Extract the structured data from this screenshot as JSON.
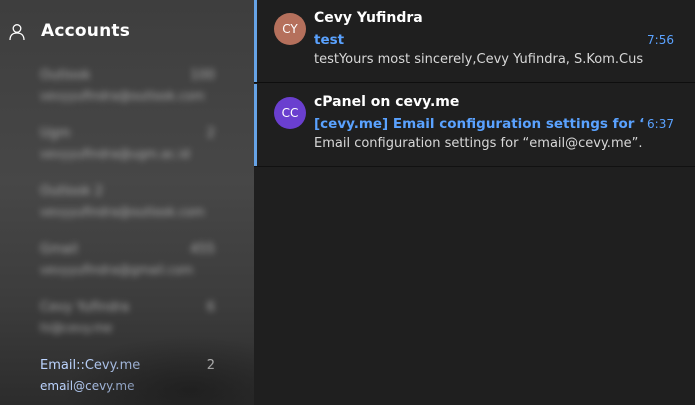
{
  "sidebar": {
    "title": "Accounts",
    "accounts": [
      {
        "name": "Outlook",
        "count": "100",
        "email": "vevyyufindra@outlook.com"
      },
      {
        "name": "Ugm",
        "count": "2",
        "email": "vevyyufindra@ugm.ac.id"
      },
      {
        "name": "Outlook 2",
        "count": "",
        "email": "vevyyufindra@outlook.com"
      },
      {
        "name": "Gmail",
        "count": "455",
        "email": "vevyyufindra@gmail.com"
      },
      {
        "name": "Cevy Yufindra",
        "count": "6",
        "email": "hi@cevy.me"
      },
      {
        "name": "Email::Cevy.me",
        "count": "2",
        "email": "email@cevy.me"
      }
    ]
  },
  "messages": [
    {
      "initials": "CY",
      "avatar_color": "#b5705c",
      "sender": "Cevy Yufindra",
      "subject": "test",
      "time": "7:56",
      "preview": "testYours most sincerely,Cevy Yufindra, S.Kom.Cus"
    },
    {
      "initials": "CC",
      "avatar_color": "#6a3fcf",
      "sender": "cPanel on cevy.me",
      "subject": "[cevy.me] Email configuration settings for “email",
      "time": "6:37",
      "preview": "Email configuration settings for “email@cevy.me”."
    }
  ],
  "colors": {
    "accent": "#66a3e6",
    "link": "#5aa2ff"
  }
}
